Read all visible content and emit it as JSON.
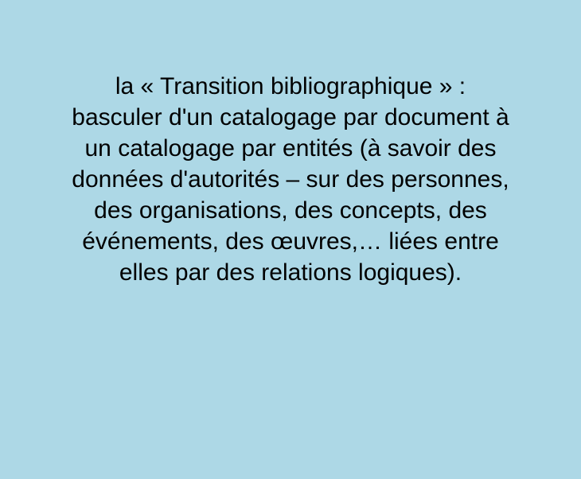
{
  "slide": {
    "background_color": "#ADD8E6",
    "text_color": "#000000",
    "lines": [
      "la « Transition bibliographique » :",
      "basculer d'un catalogage par document à",
      "un catalogage par entités (à savoir des",
      "données d'autorités – sur des personnes,",
      "des organisations, des concepts, des",
      "événements, des œuvres,… liées entre",
      "elles par des relations logiques)."
    ]
  }
}
